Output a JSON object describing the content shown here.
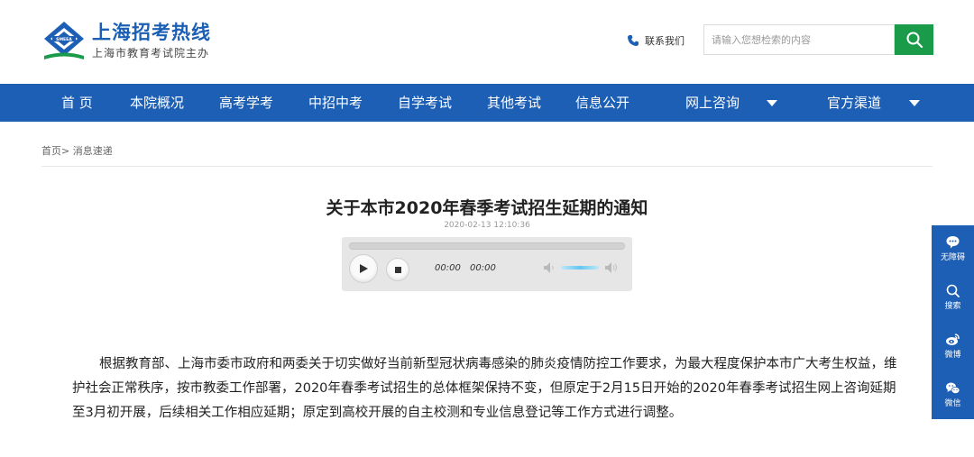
{
  "header": {
    "site_title": "上海招考热线",
    "site_subtitle": "上海市教育考试院主办",
    "logo_text": "SMEEA",
    "contact_label": "联系我们",
    "search_placeholder": "请输入您想检索的内容",
    "brand_color": "#1c5fb5",
    "search_button_color": "#1a9b4a"
  },
  "nav": {
    "items": [
      {
        "label": "首 页"
      },
      {
        "label": "本院概况"
      },
      {
        "label": "高考学考"
      },
      {
        "label": "中招中考"
      },
      {
        "label": "自学考试"
      },
      {
        "label": "其他考试"
      },
      {
        "label": "信息公开"
      },
      {
        "label": "网上咨询",
        "dropdown": true
      },
      {
        "label": "官方渠道",
        "dropdown": true
      }
    ]
  },
  "breadcrumb": {
    "home": "首页>",
    "current": "消息速递"
  },
  "article": {
    "title": "关于本市2020年春季考试招生延期的通知",
    "date": "2020-02-13 12:10:36",
    "body": "根据教育部、上海市委市政府和两委关于切实做好当前新型冠状病毒感染的肺炎疫情防控工作要求，为最大程度保护本市广大考生权益，维护社会正常秩序，按市教委工作部署，2020年春季考试招生的总体框架保持不变，但原定于2月15日开始的2020年春季考试招生网上咨询延期至3月初开展，后续相关工作相应延期；原定到高校开展的自主校测和专业信息登记等工作方式进行调整。"
  },
  "player": {
    "current_time": "00:00",
    "duration": "00:00"
  },
  "side_toolbar": {
    "items": [
      {
        "label": "无障碍",
        "icon": "chat-bubble-icon"
      },
      {
        "label": "搜索",
        "icon": "search-icon"
      },
      {
        "label": "微博",
        "icon": "weibo-icon"
      },
      {
        "label": "微信",
        "icon": "wechat-icon"
      }
    ]
  }
}
